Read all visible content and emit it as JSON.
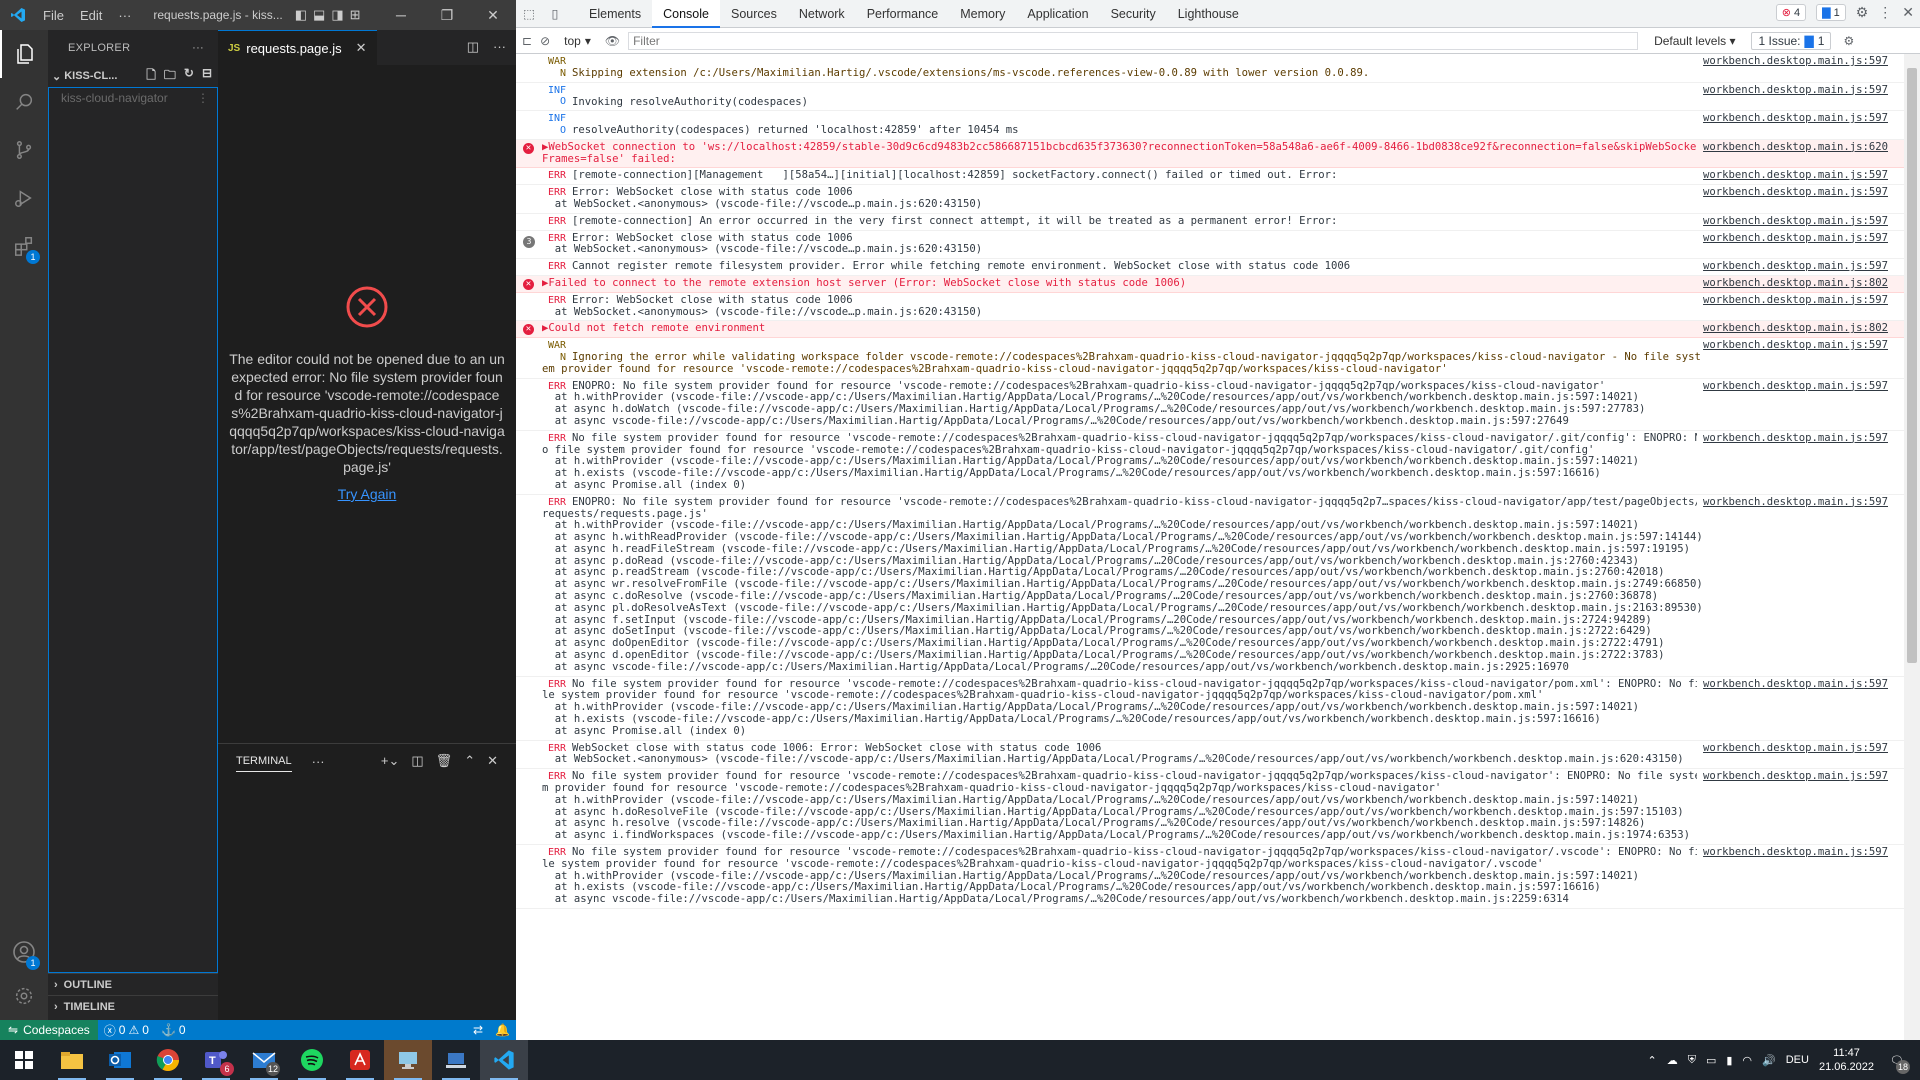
{
  "vscode": {
    "menu": [
      "File",
      "Edit",
      "···"
    ],
    "window_title": "requests.page.js - kiss...",
    "explorer_title": "EXPLORER",
    "workspace": "KISS-CL...",
    "tree_item": "kiss-cloud-navigator",
    "tab": {
      "lang": "JS",
      "name": "requests.page.js"
    },
    "error_message": "The editor could not be opened due to an unexpected error: No file system provider found for resource 'vscode-remote://codespaces%2Brahxam-quadrio-kiss-cloud-navigator-jqqqq5q2p7qp/workspaces/kiss-cloud-navigator/app/test/pageObjects/requests/requests.page.js'",
    "try_again": "Try Again",
    "terminal_label": "TERMINAL",
    "outline": "OUTLINE",
    "timeline": "TIMELINE",
    "badges": {
      "extensions": "1",
      "accounts": "1"
    },
    "status": {
      "remote": "Codespaces",
      "errors": "0",
      "warnings": "0",
      "ports": "0"
    }
  },
  "devtools": {
    "tabs": [
      "Elements",
      "Console",
      "Sources",
      "Network",
      "Performance",
      "Memory",
      "Application",
      "Security",
      "Lighthouse"
    ],
    "active_tab": "Console",
    "error_count": "4",
    "message_count": "1",
    "context": "top",
    "filter_placeholder": "Filter",
    "levels": "Default levels",
    "issues": "1 Issue:",
    "issues_count": "1",
    "messages": [
      {
        "kind": "warn",
        "level": "WARN",
        "text": "Skipping extension /c:/Users/Maximilian.Hartig/.vscode/extensions/ms-vscode.references-view-0.0.89 with lower version 0.0.89.",
        "source": "workbench.desktop.main.js:597"
      },
      {
        "kind": "info",
        "level": "INFO",
        "text": "Invoking resolveAuthority(codespaces)",
        "source": "workbench.desktop.main.js:597"
      },
      {
        "kind": "info",
        "level": "INFO",
        "text": "resolveAuthority(codespaces) returned 'localhost:42859' after 10454 ms",
        "source": "workbench.desktop.main.js:597"
      },
      {
        "kind": "err",
        "level": "",
        "text": "▶WebSocket connection to 'ws://localhost:42859/stable-30d9c6cd9483b2cc586687151bcbcd635f373630?reconnectionToken=58a548a6-ae6f-4009-8466-1bd0838ce92f&reconnection=false&skipWebSocketFrames=false' failed:",
        "source": "workbench.desktop.main.js:620"
      },
      {
        "kind": "err2",
        "level": "ERR",
        "text": "[remote-connection][Management   ][58a54…][initial][localhost:42859] socketFactory.connect() failed or timed out. Error:",
        "source": "workbench.desktop.main.js:597"
      },
      {
        "kind": "err2",
        "level": "ERR",
        "text": "Error: WebSocket close with status code 1006\n  at WebSocket.<anonymous> (vscode-file://vscode…p.main.js:620:43150)",
        "source": "workbench.desktop.main.js:597"
      },
      {
        "kind": "err2",
        "level": "ERR",
        "text": "[remote-connection] An error occurred in the very first connect attempt, it will be treated as a permanent error! Error:",
        "source": "workbench.desktop.main.js:597"
      },
      {
        "kind": "err2",
        "level": "ERR",
        "group": "3",
        "text": "Error: WebSocket close with status code 1006\n  at WebSocket.<anonymous> (vscode-file://vscode…p.main.js:620:43150)",
        "source": "workbench.desktop.main.js:597"
      },
      {
        "kind": "err2",
        "level": "ERR",
        "text": "Cannot register remote filesystem provider. Error while fetching remote environment. WebSocket close with status code 1006",
        "source": "workbench.desktop.main.js:597"
      },
      {
        "kind": "err",
        "level": "",
        "text": "▶Failed to connect to the remote extension host server (Error: WebSocket close with status code 1006)",
        "source": "workbench.desktop.main.js:802"
      },
      {
        "kind": "err2",
        "level": "ERR",
        "text": "Error: WebSocket close with status code 1006\n  at WebSocket.<anonymous> (vscode-file://vscode…p.main.js:620:43150)",
        "source": "workbench.desktop.main.js:597"
      },
      {
        "kind": "err",
        "level": "",
        "text": "▶Could not fetch remote environment",
        "source": "workbench.desktop.main.js:802"
      },
      {
        "kind": "warn",
        "level": "WARN",
        "text": "Ignoring the error while validating workspace folder vscode-remote://codespaces%2Brahxam-quadrio-kiss-cloud-navigator-jqqqq5q2p7qp/workspaces/kiss-cloud-navigator - No file system provider found for resource 'vscode-remote://codespaces%2Brahxam-quadrio-kiss-cloud-navigator-jqqqq5q2p7qp/workspaces/kiss-cloud-navigator'",
        "source": "workbench.desktop.main.js:597"
      },
      {
        "kind": "err2",
        "level": "ERR",
        "text": "ENOPRO: No file system provider found for resource 'vscode-remote://codespaces%2Brahxam-quadrio-kiss-cloud-navigator-jqqqq5q2p7qp/workspaces/kiss-cloud-navigator'\n  at h.withProvider (vscode-file://vscode-app/c:/Users/Maximilian.Hartig/AppData/Local/Programs/…%20Code/resources/app/out/vs/workbench/workbench.desktop.main.js:597:14021)\n  at async h.doWatch (vscode-file://vscode-app/c:/Users/Maximilian.Hartig/AppData/Local/Programs/…%20Code/resources/app/out/vs/workbench/workbench.desktop.main.js:597:27783)\n  at async vscode-file://vscode-app/c:/Users/Maximilian.Hartig/AppData/Local/Programs/…%20Code/resources/app/out/vs/workbench/workbench.desktop.main.js:597:27649",
        "source": "workbench.desktop.main.js:597"
      },
      {
        "kind": "err2",
        "level": "ERR",
        "text": "No file system provider found for resource 'vscode-remote://codespaces%2Brahxam-quadrio-kiss-cloud-navigator-jqqqq5q2p7qp/workspaces/kiss-cloud-navigator/.git/config': ENOPRO: No file system provider found for resource 'vscode-remote://codespaces%2Brahxam-quadrio-kiss-cloud-navigator-jqqqq5q2p7qp/workspaces/kiss-cloud-navigator/.git/config'\n  at h.withProvider (vscode-file://vscode-app/c:/Users/Maximilian.Hartig/AppData/Local/Programs/…%20Code/resources/app/out/vs/workbench/workbench.desktop.main.js:597:14021)\n  at h.exists (vscode-file://vscode-app/c:/Users/Maximilian.Hartig/AppData/Local/Programs/…%20Code/resources/app/out/vs/workbench/workbench.desktop.main.js:597:16616)\n  at async Promise.all (index 0)",
        "source": "workbench.desktop.main.js:597"
      },
      {
        "kind": "err2",
        "level": "ERR",
        "text": "ENOPRO: No file system provider found for resource 'vscode-remote://codespaces%2Brahxam-quadrio-kiss-cloud-navigator-jqqqq5q2p7…spaces/kiss-cloud-navigator/app/test/pageObjects/requests/requests.page.js'\n  at h.withProvider (vscode-file://vscode-app/c:/Users/Maximilian.Hartig/AppData/Local/Programs/…%20Code/resources/app/out/vs/workbench/workbench.desktop.main.js:597:14021)\n  at async h.withReadProvider (vscode-file://vscode-app/c:/Users/Maximilian.Hartig/AppData/Local/Programs/…%20Code/resources/app/out/vs/workbench/workbench.desktop.main.js:597:14144)\n  at async h.readFileStream (vscode-file://vscode-app/c:/Users/Maximilian.Hartig/AppData/Local/Programs/…%20Code/resources/app/out/vs/workbench/workbench.desktop.main.js:597:19195)\n  at async p.doRead (vscode-file://vscode-app/c:/Users/Maximilian.Hartig/AppData/Local/Programs/…20Code/resources/app/out/vs/workbench/workbench.desktop.main.js:2760:42343)\n  at async p.readStream (vscode-file://vscode-app/c:/Users/Maximilian.Hartig/AppData/Local/Programs/…20Code/resources/app/out/vs/workbench/workbench.desktop.main.js:2760:42018)\n  at async wr.resolveFromFile (vscode-file://vscode-app/c:/Users/Maximilian.Hartig/AppData/Local/Programs/…20Code/resources/app/out/vs/workbench/workbench.desktop.main.js:2749:66850)\n  at async c.doResolve (vscode-file://vscode-app/c:/Users/Maximilian.Hartig/AppData/Local/Programs/…20Code/resources/app/out/vs/workbench/workbench.desktop.main.js:2760:36878)\n  at async pl.doResolveAsText (vscode-file://vscode-app/c:/Users/Maximilian.Hartig/AppData/Local/Programs/…20Code/resources/app/out/vs/workbench/workbench.desktop.main.js:2163:89530)\n  at async f.setInput (vscode-file://vscode-app/c:/Users/Maximilian.Hartig/AppData/Local/Programs/…20Code/resources/app/out/vs/workbench/workbench.desktop.main.js:2724:94289)\n  at async doSetInput (vscode-file://vscode-app/c:/Users/Maximilian.Hartig/AppData/Local/Programs/…%20Code/resources/app/out/vs/workbench/workbench.desktop.main.js:2722:6429)\n  at async doOpenEditor (vscode-file://vscode-app/c:/Users/Maximilian.Hartig/AppData/Local/Programs/…%20Code/resources/app/out/vs/workbench/workbench.desktop.main.js:2722:4791)\n  at async d.openEditor (vscode-file://vscode-app/c:/Users/Maximilian.Hartig/AppData/Local/Programs/…%20Code/resources/app/out/vs/workbench/workbench.desktop.main.js:2722:3783)\n  at async vscode-file://vscode-app/c:/Users/Maximilian.Hartig/AppData/Local/Programs/…20Code/resources/app/out/vs/workbench/workbench.desktop.main.js:2925:16970",
        "source": "workbench.desktop.main.js:597"
      },
      {
        "kind": "err2",
        "level": "ERR",
        "text": "No file system provider found for resource 'vscode-remote://codespaces%2Brahxam-quadrio-kiss-cloud-navigator-jqqqq5q2p7qp/workspaces/kiss-cloud-navigator/pom.xml': ENOPRO: No file system provider found for resource 'vscode-remote://codespaces%2Brahxam-quadrio-kiss-cloud-navigator-jqqqq5q2p7qp/workspaces/kiss-cloud-navigator/pom.xml'\n  at h.withProvider (vscode-file://vscode-app/c:/Users/Maximilian.Hartig/AppData/Local/Programs/…%20Code/resources/app/out/vs/workbench/workbench.desktop.main.js:597:14021)\n  at h.exists (vscode-file://vscode-app/c:/Users/Maximilian.Hartig/AppData/Local/Programs/…%20Code/resources/app/out/vs/workbench/workbench.desktop.main.js:597:16616)\n  at async Promise.all (index 0)",
        "source": "workbench.desktop.main.js:597"
      },
      {
        "kind": "err2",
        "level": "ERR",
        "text": "WebSocket close with status code 1006: Error: WebSocket close with status code 1006\n  at WebSocket.<anonymous> (vscode-file://vscode-app/c:/Users/Maximilian.Hartig/AppData/Local/Programs/…%20Code/resources/app/out/vs/workbench/workbench.desktop.main.js:620:43150)",
        "source": "workbench.desktop.main.js:597"
      },
      {
        "kind": "err2",
        "level": "ERR",
        "text": "No file system provider found for resource 'vscode-remote://codespaces%2Brahxam-quadrio-kiss-cloud-navigator-jqqqq5q2p7qp/workspaces/kiss-cloud-navigator': ENOPRO: No file system provider found for resource 'vscode-remote://codespaces%2Brahxam-quadrio-kiss-cloud-navigator-jqqqq5q2p7qp/workspaces/kiss-cloud-navigator'\n  at h.withProvider (vscode-file://vscode-app/c:/Users/Maximilian.Hartig/AppData/Local/Programs/…%20Code/resources/app/out/vs/workbench/workbench.desktop.main.js:597:14021)\n  at async h.doResolveFile (vscode-file://vscode-app/c:/Users/Maximilian.Hartig/AppData/Local/Programs/…%20Code/resources/app/out/vs/workbench/workbench.desktop.main.js:597:15103)\n  at async h.resolve (vscode-file://vscode-app/c:/Users/Maximilian.Hartig/AppData/Local/Programs/…%20Code/resources/app/out/vs/workbench/workbench.desktop.main.js:597:14826)\n  at async i.findWorkspaces (vscode-file://vscode-app/c:/Users/Maximilian.Hartig/AppData/Local/Programs/…%20Code/resources/app/out/vs/workbench/workbench.desktop.main.js:1974:6353)",
        "source": "workbench.desktop.main.js:597"
      },
      {
        "kind": "err2",
        "level": "ERR",
        "text": "No file system provider found for resource 'vscode-remote://codespaces%2Brahxam-quadrio-kiss-cloud-navigator-jqqqq5q2p7qp/workspaces/kiss-cloud-navigator/.vscode': ENOPRO: No file system provider found for resource 'vscode-remote://codespaces%2Brahxam-quadrio-kiss-cloud-navigator-jqqqq5q2p7qp/workspaces/kiss-cloud-navigator/.vscode'\n  at h.withProvider (vscode-file://vscode-app/c:/Users/Maximilian.Hartig/AppData/Local/Programs/…%20Code/resources/app/out/vs/workbench/workbench.desktop.main.js:597:14021)\n  at h.exists (vscode-file://vscode-app/c:/Users/Maximilian.Hartig/AppData/Local/Programs/…%20Code/resources/app/out/vs/workbench/workbench.desktop.main.js:597:16616)\n  at async vscode-file://vscode-app/c:/Users/Maximilian.Hartig/AppData/Local/Programs/…%20Code/resources/app/out/vs/workbench/workbench.desktop.main.js:2259:6314",
        "source": "workbench.desktop.main.js:597"
      }
    ]
  },
  "taskbar": {
    "apps": [
      "start-icon",
      "file-explorer-icon",
      "outlook-icon",
      "chrome-icon",
      "teams-icon",
      "mail-icon",
      "spotify-icon",
      "acrobat-icon",
      "remote-desktop-icon",
      "network-tool-icon",
      "vscode-icon"
    ],
    "teams_badge": "6",
    "mail_badge": "12",
    "language": "DEU",
    "time": "11:47",
    "date": "21.06.2022",
    "notifications": "18"
  }
}
